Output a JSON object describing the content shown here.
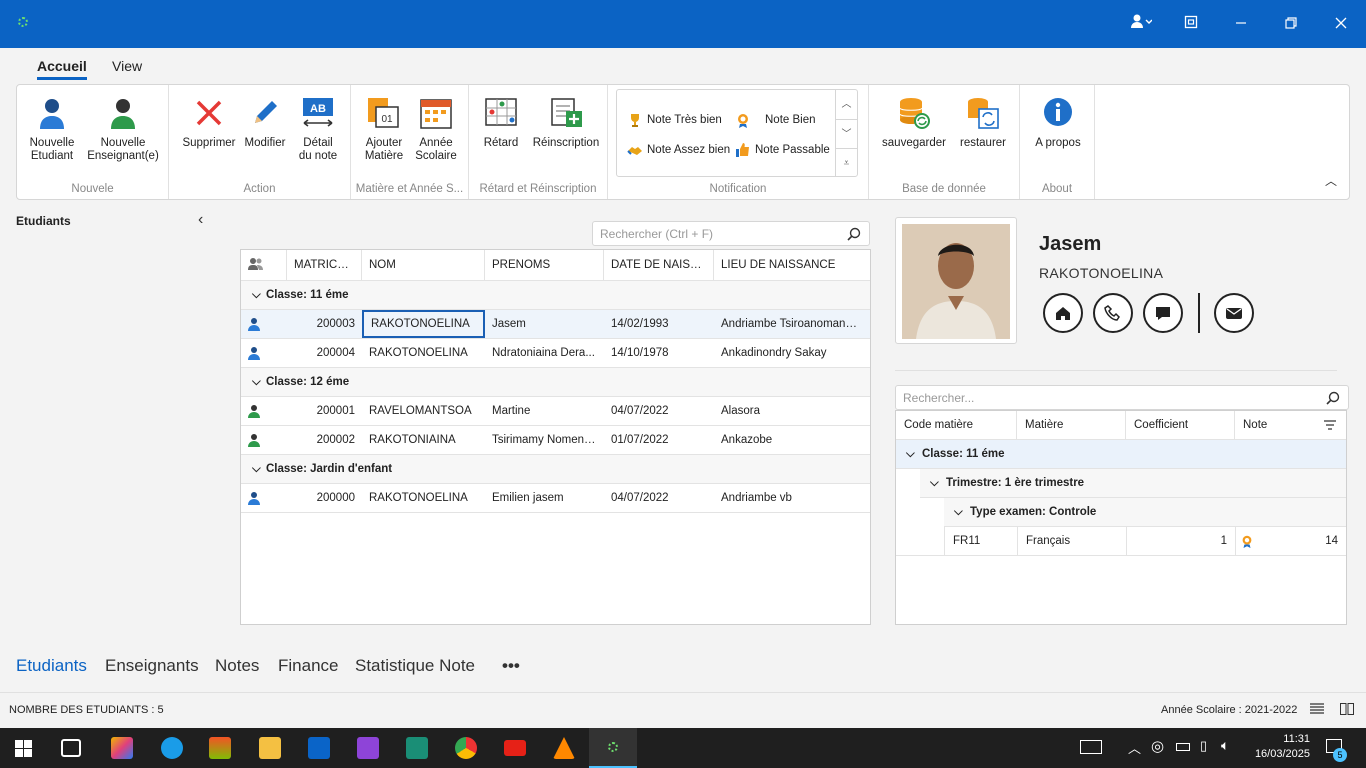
{
  "window": {
    "controls": {
      "user": "user-menu",
      "restore_app": "app-icon",
      "minimize": "minimize",
      "maximize": "maximize",
      "close": "close"
    }
  },
  "ribbon_tabs": [
    "Accueil",
    "View"
  ],
  "ribbon": {
    "nouvele": {
      "label": "Nouvele",
      "new_student": [
        "Nouvelle",
        "Etudiant"
      ],
      "new_teacher": [
        "Nouvelle",
        "Enseignant(e)"
      ]
    },
    "action": {
      "label": "Action",
      "delete": "Supprimer",
      "edit": "Modifier",
      "detail": [
        "Détail",
        "du note"
      ]
    },
    "matiere": {
      "label": "Matière et Année S...",
      "add_subject": [
        "Ajouter",
        "Matière"
      ],
      "school_year": [
        "Année",
        "Scolaire"
      ]
    },
    "retard": {
      "label": "Rétard et Réinscription",
      "late": "Rétard",
      "reinscription": "Réinscription"
    },
    "notification": {
      "label": "Notification",
      "items": [
        "Note Très bien",
        "Note Bien",
        "Note Assez bien",
        "Note Passable"
      ]
    },
    "database": {
      "label": "Base de donnée",
      "save": "sauvegarder",
      "restore": "restaurer"
    },
    "about": {
      "label": "About",
      "apropos": "A propos"
    }
  },
  "sidebar": {
    "title": "Etudiants"
  },
  "search": {
    "placeholder": "Rechercher (Ctrl + F)"
  },
  "students_grid": {
    "columns": [
      "MATRICULE",
      "NOM",
      "PRENOMS",
      "DATE DE NAISSA...",
      "LIEU DE NAISSANCE"
    ],
    "groups": [
      {
        "label": "Classe: 11 éme",
        "rows": [
          {
            "matricule": "200003",
            "nom": "RAKOTONOELINA",
            "prenoms": "Jasem",
            "date": "14/02/1993",
            "lieu": "Andriambe Tsiroanomandidy"
          },
          {
            "matricule": "200004",
            "nom": "RAKOTONOELINA",
            "prenoms": "Ndratoniaina Dera...",
            "date": "14/10/1978",
            "lieu": "Ankadinondry Sakay"
          }
        ]
      },
      {
        "label": "Classe: 12 éme",
        "rows": [
          {
            "matricule": "200001",
            "nom": "RAVELOMANTSOA",
            "prenoms": "Martine",
            "date": "04/07/2022",
            "lieu": "Alasora"
          },
          {
            "matricule": "200002",
            "nom": "RAKOTONIAINA",
            "prenoms": "Tsirimamy Nomenja...",
            "date": "01/07/2022",
            "lieu": "Ankazobe"
          }
        ]
      },
      {
        "label": "Classe: Jardin d'enfant",
        "rows": [
          {
            "matricule": "200000",
            "nom": "RAKOTONOELINA",
            "prenoms": "Emilien jasem",
            "date": "04/07/2022",
            "lieu": "Andriambe vb"
          }
        ]
      }
    ]
  },
  "profile": {
    "first_name": "Jasem",
    "last_name": "RAKOTONOELINA"
  },
  "notes_search": {
    "placeholder": "Rechercher..."
  },
  "notes_grid": {
    "columns": [
      "Code matière",
      "Matière",
      "Coefficient",
      "Note"
    ],
    "group1": "Classe: 11 éme",
    "group2": "Trimestre: 1 ère trimestre",
    "group3": "Type examen: Controle",
    "row": {
      "code": "FR11",
      "matiere": "Français",
      "coef": "1",
      "note": "14"
    }
  },
  "bottom_tabs": [
    "Etudiants",
    "Enseignants",
    "Notes",
    "Finance",
    "Statistique Note",
    "•••"
  ],
  "status": {
    "count": "NOMBRE DES ETUDIANTS : 5",
    "year": "Année Scolaire : 2021-2022"
  },
  "taskbar": {
    "time": "11:31",
    "date": "16/03/2025",
    "notif_count": "5"
  },
  "colors": {
    "titlebar": "#0b63c4",
    "accent": "#0b63c4",
    "taskbar": "#1f1f1f"
  }
}
